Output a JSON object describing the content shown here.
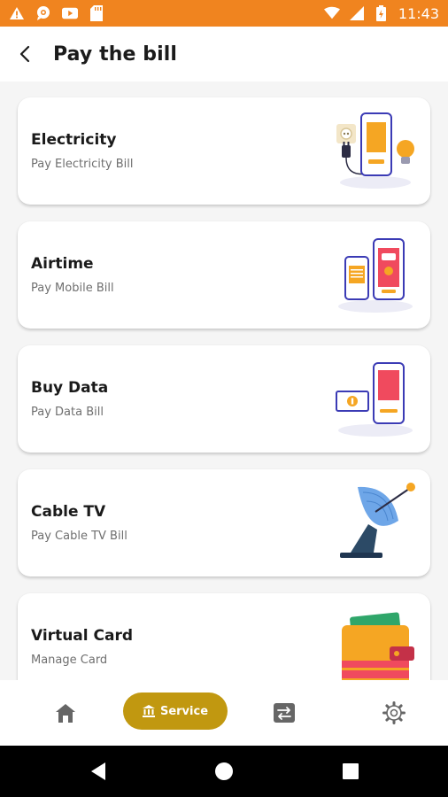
{
  "status_bar": {
    "time": "11:43",
    "left_icons": [
      "warning-icon",
      "chat-bubble-icon",
      "youtube-icon",
      "sd-card-icon"
    ],
    "right_icons": [
      "wifi-icon",
      "signal-icon",
      "battery-icon"
    ]
  },
  "header": {
    "title": "Pay the bill",
    "back_icon": "chevron-left-icon"
  },
  "cards": [
    {
      "title": "Electricity",
      "subtitle": "Pay Electricity Bill",
      "illustration": "electricity-illustration"
    },
    {
      "title": "Airtime",
      "subtitle": "Pay Mobile Bill",
      "illustration": "airtime-illustration"
    },
    {
      "title": "Buy Data",
      "subtitle": "Pay Data Bill",
      "illustration": "data-illustration"
    },
    {
      "title": "Cable TV",
      "subtitle": "Pay Cable TV Bill",
      "illustration": "satellite-dish-illustration"
    },
    {
      "title": "Virtual Card",
      "subtitle": "Manage Card",
      "illustration": "wallet-illustration"
    }
  ],
  "bottom_nav": {
    "items": [
      {
        "icon": "home-icon"
      },
      {
        "icon": "bank-icon",
        "label": "Service",
        "active": true
      },
      {
        "icon": "transfer-icon"
      },
      {
        "icon": "gear-icon"
      }
    ]
  },
  "colors": {
    "status_bar": "#f0841f",
    "accent": "#c19810",
    "background": "#f5f5f5"
  }
}
